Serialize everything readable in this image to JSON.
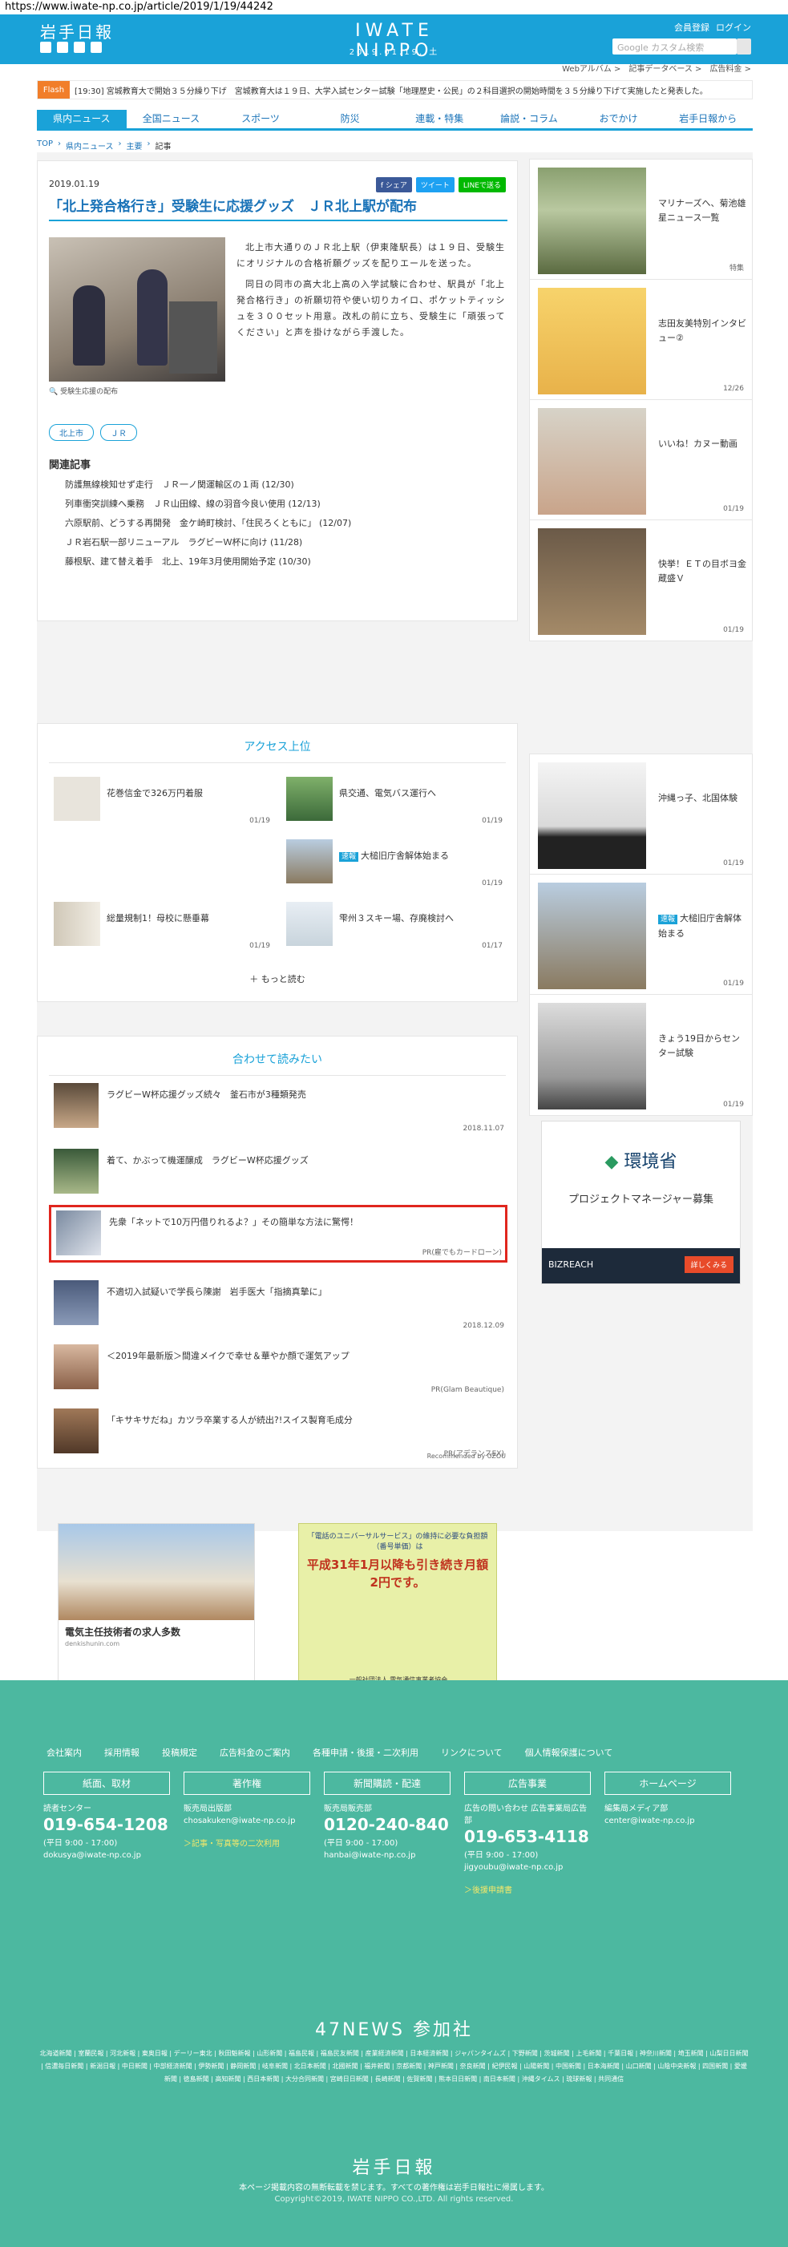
{
  "url": "https://www.iwate-np.co.jp/article/2019/1/19/44242",
  "header": {
    "logo_jp": "岩手日報",
    "brand": "IWATE NIPPO",
    "date": "2019.01.19. 土",
    "links": [
      "会員登録",
      "ログイン"
    ],
    "search_placeholder": "Google カスタム検索",
    "sub_links": [
      "Webアルバム >",
      "記事データベース >",
      "広告料金 >"
    ]
  },
  "flash": {
    "label": "Flash",
    "text": "[19:30] 宮城教育大で開始３５分繰り下げ　宮城教育大は１９日、大学入試センター試験「地理歴史・公民」の２科目選択の開始時間を３５分繰り下げて実施したと発表した。"
  },
  "nav": [
    "県内ニュース",
    "全国ニュース",
    "スポーツ",
    "防災",
    "連載・特集",
    "論説・コラム",
    "おでかけ",
    "岩手日報から"
  ],
  "breadcrumb": [
    "TOP",
    "県内ニュース",
    "主要",
    "記事"
  ],
  "article": {
    "date": "2019.01.19",
    "share": [
      "f シェア",
      "ツイート",
      "LINEで送る"
    ],
    "title": "「北上発合格行き」受験生に応援グッズ　ＪＲ北上駅が配布",
    "caption": "受験生応援の配布",
    "body": [
      "北上市大通りのＪＲ北上駅（伊東隆駅長）は１９日、受験生にオリジナルの合格祈願グッズを配りエールを送った。",
      "同日の同市の高大北上高の入学試験に合わせ、駅員が「北上発合格行き」の祈願切符や使い切りカイロ、ポケットティッシュを３００セット用意。改札の前に立ち、受験生に「頑張ってください」と声を掛けながら手渡した。"
    ],
    "tags": [
      "北上市",
      "ＪＲ"
    ],
    "related_title": "関連記事",
    "related": [
      "防護無線検知せず走行　ＪＲ一ノ関運輸区の１両 (12/30)",
      "列車衝突訓練へ乗務　ＪＲ山田線、線の羽音今良い使用 (12/13)",
      "六原駅前、どうする再開発　金ケ崎町検討、「住民ろくともに」 (12/07)",
      "ＪＲ岩石駅一部リニューアル　ラグビーＷ杯に向け (11/28)",
      "藤根駅、建て替え着手　北上、19年3月使用開始予定 (10/30)"
    ]
  },
  "sidebar_top": [
    {
      "title": "マリナーズへ、菊池雄星ニュース一覧",
      "date": "特集"
    },
    {
      "title": "志田友美特別インタビュー②",
      "date": "12/26"
    },
    {
      "title": "いいね！カヌー動画",
      "date": "01/19"
    },
    {
      "title": "快挙！ＥＴの目ボヨ金蔵盛Ｖ",
      "date": "01/19"
    }
  ],
  "ranking": {
    "title": "アクセス上位",
    "items": [
      {
        "title": "花巻信金で326万円着服",
        "date": "01/19",
        "badge": ""
      },
      {
        "title": "県交通、電気バス運行へ",
        "date": "01/19",
        "badge": ""
      },
      {
        "title": "大槌旧庁舎解体始まる",
        "date": "01/19",
        "badge": "速報"
      },
      {
        "title": "総量規制1！母校に懸垂幕",
        "date": "01/19",
        "badge": ""
      },
      {
        "title": "雫州３スキー場、存廃検討へ",
        "date": "01/17",
        "badge": ""
      }
    ],
    "more": "もっと読む"
  },
  "sidebar_mid": [
    {
      "title": "沖縄っ子、北国体験",
      "date": "01/19",
      "badge": ""
    },
    {
      "title": "大槌旧庁舎解体始まる",
      "date": "01/19",
      "badge": "速報"
    },
    {
      "title": "きょう19日からセンター試験",
      "date": "01/19",
      "badge": ""
    }
  ],
  "recommend": {
    "title": "合わせて読みたい",
    "items": [
      {
        "title": "ラグビーW杯応援グッズ続々　釜石市が3種類発売",
        "date": "2018.11.07"
      },
      {
        "title": "着て、かぶって機運醸成　ラグビーW杯応援グッズ",
        "date": ""
      },
      {
        "title": "先衆「ネットで10万円借りれるよ？」その簡単な方法に驚愕！",
        "date": "PR(雇でもカードローン)"
      },
      {
        "title": "不適切入試疑いで学長ら陳謝　岩手医大「指摘真摯に」",
        "date": "2018.12.09"
      },
      {
        "title": "＜2019年最新版＞間違メイクで幸せ＆華やか顔で運気アップ",
        "date": "PR(Glam Beautique)"
      },
      {
        "title": "「キサキサだね」カツラ卒業する人が続出?!スイス製育毛成分",
        "date": "PR(アデランスEX)"
      }
    ],
    "footer": "Recommended by UZOU"
  },
  "ads": {
    "side_env": {
      "title": "環境省",
      "sub": "プロジェクトマネージャー募集",
      "foot": "BIZREACH",
      "btn": "詳しくみる"
    },
    "job": {
      "title": "電気主任技術者の求人多数",
      "url": "denkishunin.com"
    },
    "universal": {
      "text1": "「電話のユニバーサルサービス」の維持に必要な負担額（番号単価）は",
      "big": "平成31年1月以降も引き続き月額2円です。",
      "text2": "一般社団法人 電気通信事業者協会"
    }
  },
  "footer": {
    "links": [
      "会社案内",
      "採用情報",
      "投稿規定",
      "広告料金のご案内",
      "各種申請・後援・二次利用",
      "リンクについて",
      "個人情報保護について"
    ],
    "cols": [
      {
        "head": "紙面、取材",
        "l1": "読者センター",
        "phone": "019-654-1208",
        "hours": "(平日 9:00 - 17:00)",
        "mail": "dokusya@iwate-np.co.jp",
        "extra": ""
      },
      {
        "head": "著作権",
        "l1": "販売局出版部",
        "phone": "",
        "hours": "",
        "mail": "chosakuken@iwate-np.co.jp",
        "extra": "＞記事・写真等の二次利用"
      },
      {
        "head": "新聞購読・配達",
        "l1": "販売局販売部",
        "phone": "0120-240-840",
        "hours": "(平日 9:00 - 17:00)",
        "mail": "hanbai@iwate-np.co.jp",
        "extra": ""
      },
      {
        "head": "広告事業",
        "l1": "広告の問い合わせ 広告事業局広告部",
        "phone": "019-653-4118",
        "hours": "(平日 9:00 - 17:00)",
        "mail": "jigyoubu@iwate-np.co.jp",
        "extra": "＞後援申請書"
      },
      {
        "head": "ホームページ",
        "l1": "編集局メディア部",
        "phone": "",
        "hours": "",
        "mail": "center@iwate-np.co.jp",
        "extra": ""
      }
    ],
    "title47": "47NEWS 参加社",
    "papers": "北海道新聞 | 室蘭民報 | 河北新報 | 東奥日報 | デーリー東北 | 秋田魁新報 | 山形新聞 | 福島民報 | 福島民友新聞 | 産業経済新聞 | 日本経済新聞 | ジャパンタイムズ | 下野新聞 | 茨城新聞 | 上毛新聞 | 千葉日報 | 神奈川新聞 | 埼玉新聞 | 山梨日日新聞 | 信濃毎日新聞 | 新潟日報 | 中日新聞 | 中部経済新聞 | 伊勢新聞 | 静岡新聞 | 岐阜新聞 | 北日本新聞 | 北國新聞 | 福井新聞 | 京都新聞 | 神戸新聞 | 奈良新聞 | 紀伊民報 | 山陽新聞 | 中国新聞 | 日本海新聞 | 山口新聞 | 山陰中央新報 | 四国新聞 | 愛媛新聞 | 徳島新聞 | 高知新聞 | 西日本新聞 | 大分合同新聞 | 宮崎日日新聞 | 長崎新聞 | 佐賀新聞 | 熊本日日新聞 | 南日本新聞 | 沖縄タイムス | 琉球新報 | 共同通信",
    "logo": "岩手日報",
    "copy1": "本ページ掲載内容の無断転載を禁じます。すべての著作権は岩手日報社に帰属します。",
    "copy2": "Copyright©2019, IWATE NIPPO CO.,LTD. All rights reserved."
  }
}
